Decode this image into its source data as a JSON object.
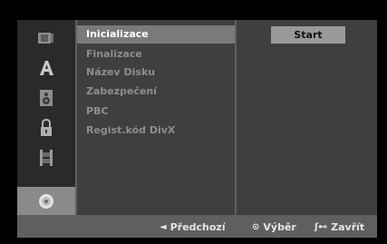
{
  "sidebar": {
    "items": [
      {
        "icon": "disc-library-icon",
        "active": false
      },
      {
        "icon": "language-letter-a-icon",
        "active": false
      },
      {
        "icon": "speaker-audio-icon",
        "active": false
      },
      {
        "icon": "padlock-icon",
        "active": false
      },
      {
        "icon": "film-strip-icon",
        "active": false
      },
      {
        "icon": "disc-icon",
        "active": true
      }
    ]
  },
  "menu": {
    "items": [
      {
        "label": "Inicializace",
        "selected": true
      },
      {
        "label": "Finalizace",
        "selected": false
      },
      {
        "label": "Název Disku",
        "selected": false
      },
      {
        "label": "Zabezpečení",
        "selected": false
      },
      {
        "label": "PBC",
        "selected": false
      },
      {
        "label": "Regist.kód DivX",
        "selected": false
      }
    ]
  },
  "panel": {
    "start_label": "Start"
  },
  "footer": {
    "previous_symbol": "◄",
    "previous_label": "Předchozí",
    "select_symbol": "⊙",
    "select_label": "Výběr",
    "close_symbol": "ʃ⊷",
    "close_label": "Zavřít"
  },
  "colors": {
    "background": "#000000",
    "frame": "#5f5f5f",
    "menu_panel": "#3f3f3f",
    "selected_item": "#7a7a7a",
    "active_icon": "#8a8a8a"
  }
}
